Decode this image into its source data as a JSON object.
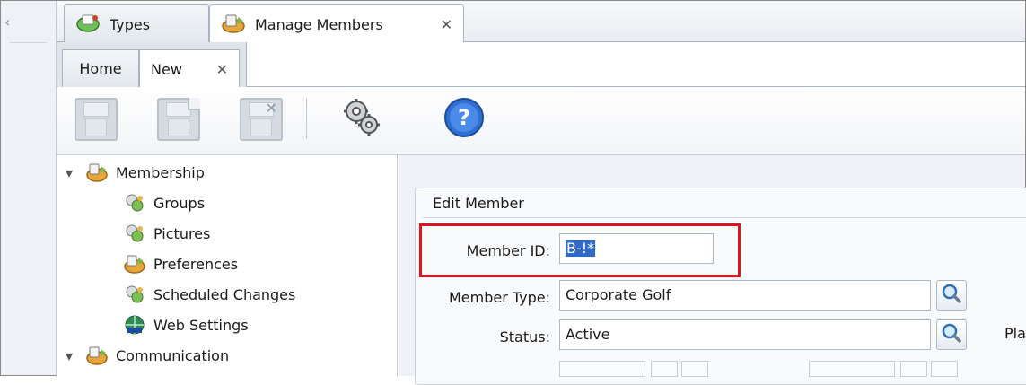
{
  "colors": {
    "accent": "#3169c6",
    "highlight": "#e0141e",
    "panel_bg": "#eef2f7"
  },
  "left_strip": {
    "icon": "collapse-icon"
  },
  "doc_tabs": [
    {
      "label": "Types",
      "icon": "types-icon"
    },
    {
      "label": "Manage Members",
      "icon": "members-icon",
      "close_glyph": "✕"
    }
  ],
  "inner_tabs": [
    {
      "label": "Home"
    },
    {
      "label": "New",
      "close_glyph": "✕"
    }
  ],
  "toolbar": {
    "buttons": [
      {
        "name": "save",
        "icon": "save-icon",
        "enabled": false
      },
      {
        "name": "new-record",
        "icon": "new-record-icon",
        "enabled": false
      },
      {
        "name": "delete",
        "icon": "delete-icon",
        "enabled": false
      },
      {
        "name": "settings",
        "icon": "gears-icon",
        "enabled": true
      },
      {
        "name": "help",
        "icon": "help-icon",
        "enabled": true,
        "glyph": "?"
      }
    ]
  },
  "tree": {
    "groups": [
      {
        "label": "Membership",
        "expanded": true,
        "icon": "membership-icon",
        "children": [
          {
            "label": "Groups",
            "icon": "groups-icon"
          },
          {
            "label": "Pictures",
            "icon": "pictures-icon"
          },
          {
            "label": "Preferences",
            "icon": "preferences-icon"
          },
          {
            "label": "Scheduled Changes",
            "icon": "scheduled-changes-icon"
          },
          {
            "label": "Web Settings",
            "icon": "web-settings-icon"
          }
        ]
      },
      {
        "label": "Communication",
        "expanded": true,
        "icon": "communication-icon"
      }
    ]
  },
  "form": {
    "group_title": "Edit Member",
    "member_id": {
      "label": "Member ID:",
      "value": "B-!*"
    },
    "member_type": {
      "label": "Member Type:",
      "value": "Corporate Golf"
    },
    "status": {
      "label": "Status:",
      "value": "Active"
    },
    "cut_label": "Pla"
  }
}
